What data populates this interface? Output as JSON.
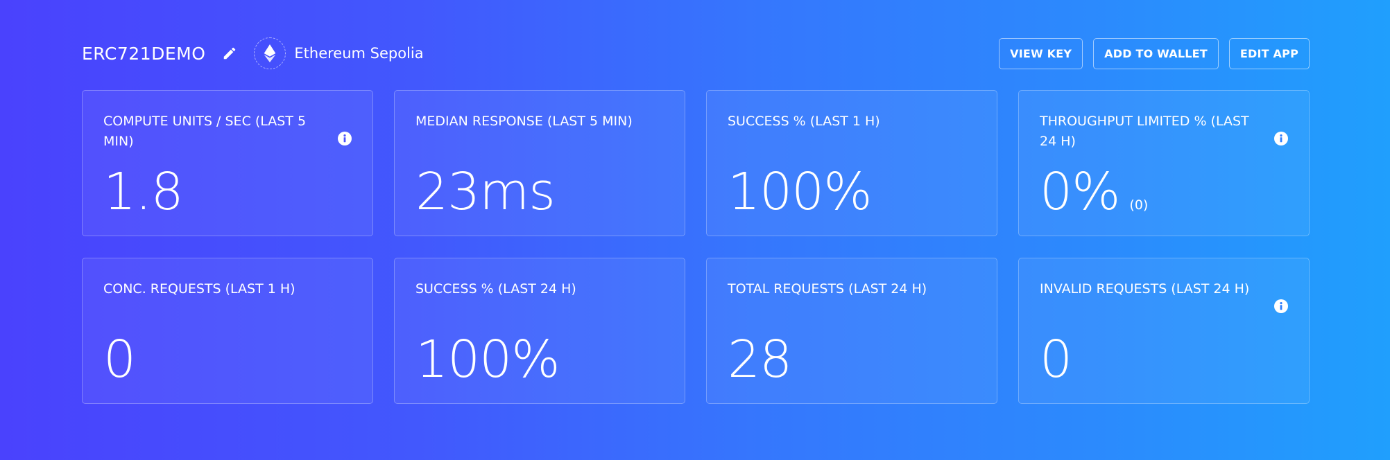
{
  "header": {
    "app_name": "ERC721DEMO",
    "network": "Ethereum Sepolia",
    "buttons": {
      "view_key": "VIEW KEY",
      "add_to_wallet": "ADD TO WALLET",
      "edit_app": "EDIT APP"
    }
  },
  "icons": {
    "edit": "pencil-icon",
    "network": "ethereum-icon",
    "info": "info-icon"
  },
  "cards": [
    {
      "label": "COMPUTE UNITS / SEC (LAST 5 MIN)",
      "value": "1.8",
      "sub": "",
      "info": true
    },
    {
      "label": "MEDIAN RESPONSE (LAST 5 MIN)",
      "value": "23ms",
      "sub": "",
      "info": false
    },
    {
      "label": "SUCCESS % (LAST 1 H)",
      "value": "100%",
      "sub": "",
      "info": false
    },
    {
      "label": "THROUGHPUT LIMITED % (LAST 24 H)",
      "value": "0%",
      "sub": "(0)",
      "info": true
    },
    {
      "label": "CONC. REQUESTS (LAST 1 H)",
      "value": "0",
      "sub": "",
      "info": false
    },
    {
      "label": "SUCCESS % (LAST 24 H)",
      "value": "100%",
      "sub": "",
      "info": false
    },
    {
      "label": "TOTAL REQUESTS (LAST 24 H)",
      "value": "28",
      "sub": "",
      "info": false
    },
    {
      "label": "INVALID REQUESTS (LAST 24 H)",
      "value": "0",
      "sub": "",
      "info": true
    }
  ],
  "colors": {
    "gradient_start": "#4a42fd",
    "gradient_end": "#209ffd",
    "text": "#ffffff"
  }
}
